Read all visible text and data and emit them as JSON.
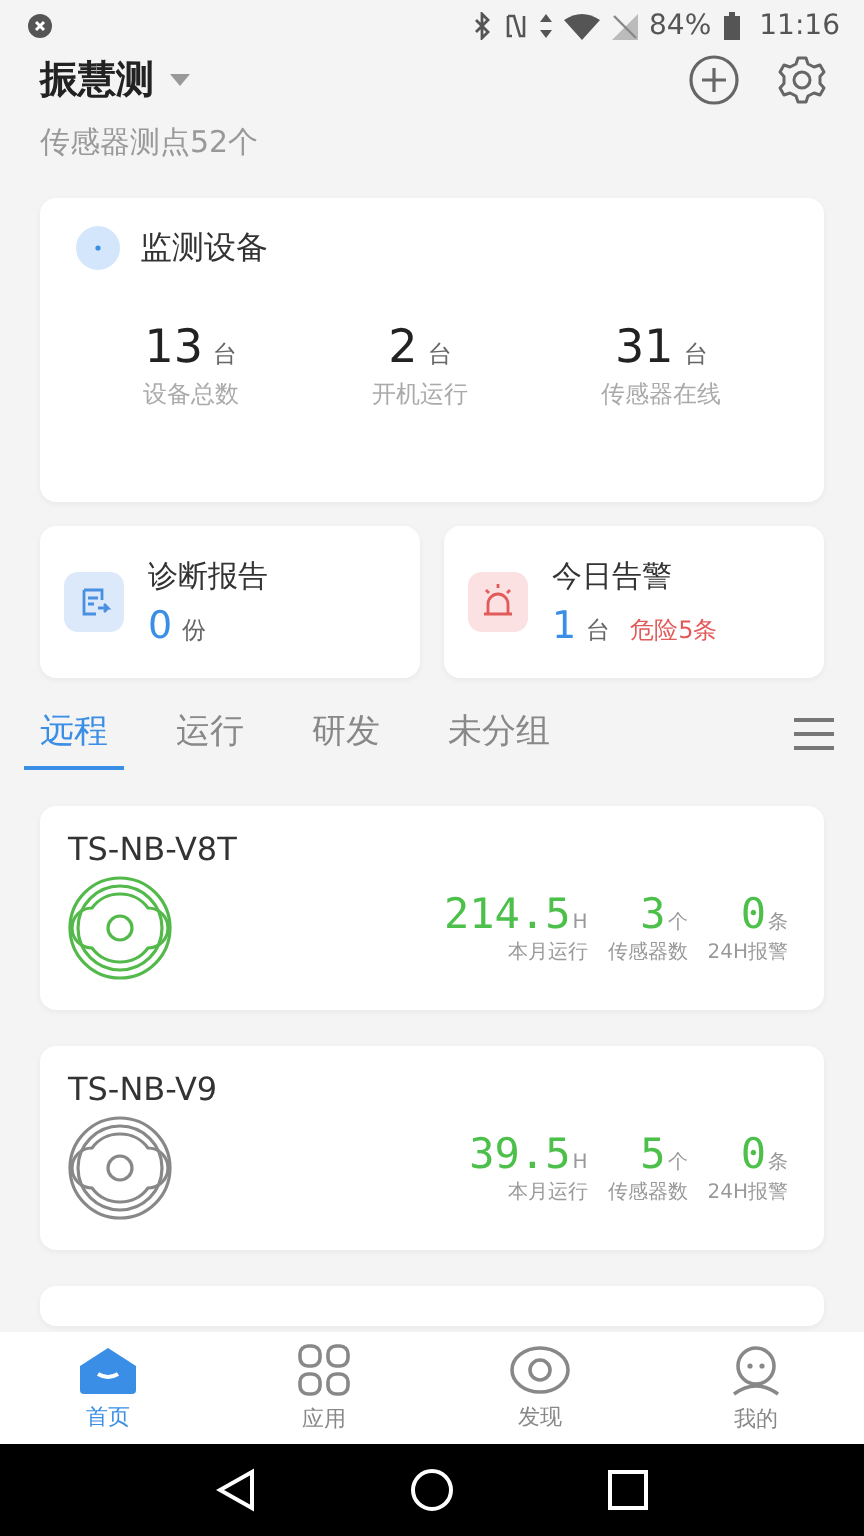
{
  "status_bar": {
    "battery": "84%",
    "time": "11:16"
  },
  "header": {
    "title": "振慧测",
    "subtitle": "传感器测点52个"
  },
  "monitor": {
    "title": "监测设备",
    "stats": [
      {
        "value": "13",
        "unit": "台",
        "label": "设备总数"
      },
      {
        "value": "2",
        "unit": "台",
        "label": "开机运行"
      },
      {
        "value": "31",
        "unit": "台",
        "label": "传感器在线"
      }
    ]
  },
  "report": {
    "title": "诊断报告",
    "value": "0",
    "unit": "份"
  },
  "alarm": {
    "title": "今日告警",
    "value": "1",
    "unit": "台",
    "danger": "危险5条"
  },
  "tabs": [
    {
      "label": "远程",
      "selected": true
    },
    {
      "label": "运行",
      "selected": false
    },
    {
      "label": "研发",
      "selected": false
    },
    {
      "label": "未分组",
      "selected": false
    }
  ],
  "devices": [
    {
      "name": "TS-NB-V8T",
      "running": true,
      "metrics": [
        {
          "value": "214.5",
          "unit": "H",
          "label": "本月运行"
        },
        {
          "value": "3",
          "unit": "个",
          "label": "传感器数"
        },
        {
          "value": "0",
          "unit": "条",
          "label": "24H报警"
        }
      ]
    },
    {
      "name": "TS-NB-V9",
      "running": false,
      "metrics": [
        {
          "value": "39.5",
          "unit": "H",
          "label": "本月运行"
        },
        {
          "value": "5",
          "unit": "个",
          "label": "传感器数"
        },
        {
          "value": "0",
          "unit": "条",
          "label": "24H报警"
        }
      ]
    }
  ],
  "bottom_nav": [
    {
      "label": "首页",
      "selected": true
    },
    {
      "label": "应用",
      "selected": false
    },
    {
      "label": "发现",
      "selected": false
    },
    {
      "label": "我的",
      "selected": false
    }
  ]
}
